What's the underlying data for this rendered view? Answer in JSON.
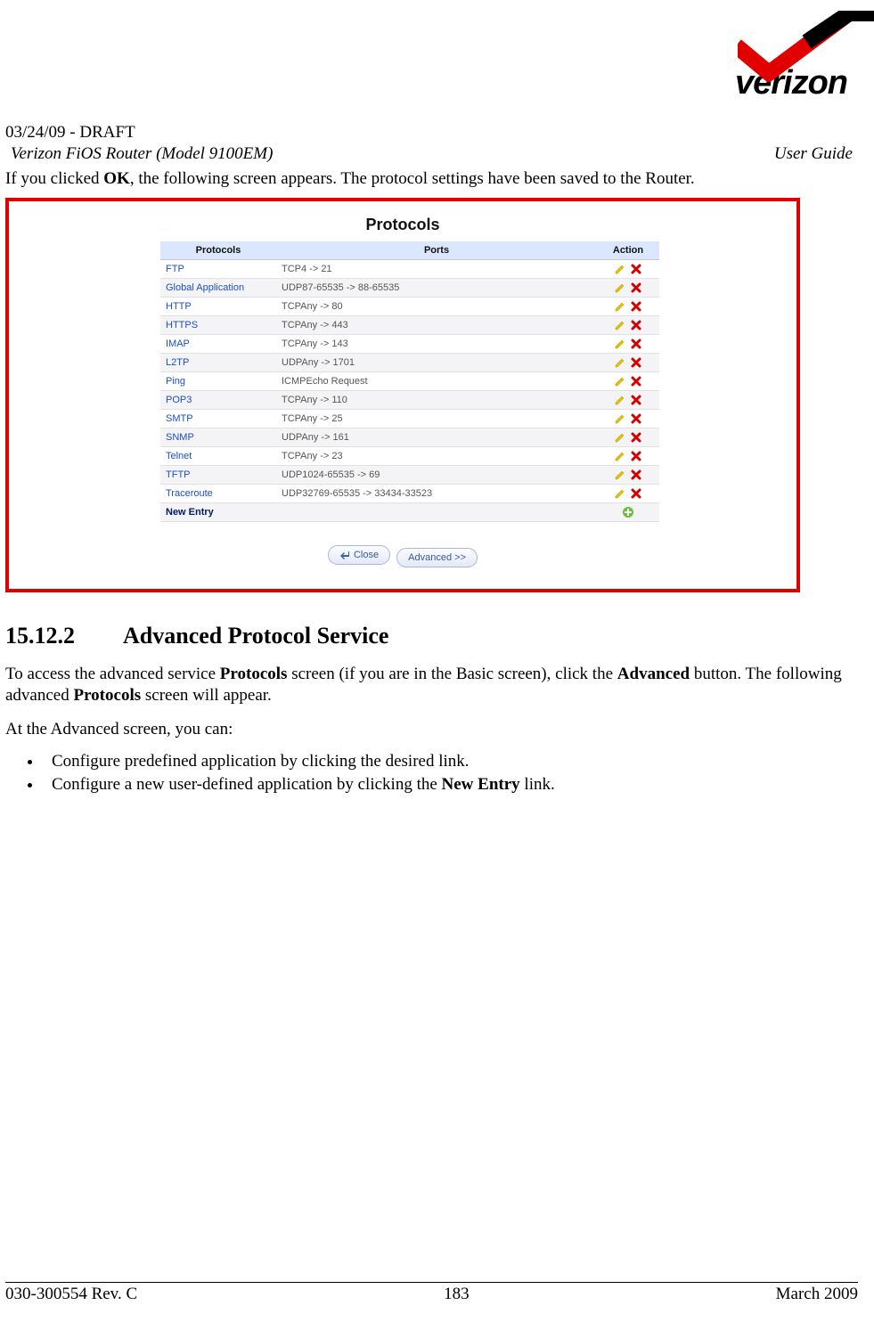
{
  "logo": {
    "brand": "verizon"
  },
  "header": {
    "draft": "03/24/09 - DRAFT",
    "left": "Verizon FiOS Router (Model 9100EM)",
    "right": "User Guide"
  },
  "intro": {
    "pre": "If you clicked ",
    "bold1": "OK",
    "post": ", the following screen appears. The protocol settings have been saved to the Router."
  },
  "panel": {
    "title": "Protocols",
    "columns": {
      "c1": "Protocols",
      "c2": "Ports",
      "c3": "Action"
    },
    "rows": [
      {
        "name": "FTP",
        "ports": "TCP4 -> 21"
      },
      {
        "name": "Global Application",
        "ports": "UDP87-65535 -> 88-65535"
      },
      {
        "name": "HTTP",
        "ports": "TCPAny -> 80"
      },
      {
        "name": "HTTPS",
        "ports": "TCPAny -> 443"
      },
      {
        "name": "IMAP",
        "ports": "TCPAny -> 143"
      },
      {
        "name": "L2TP",
        "ports": "UDPAny -> 1701"
      },
      {
        "name": "Ping",
        "ports": "ICMPEcho Request"
      },
      {
        "name": "POP3",
        "ports": "TCPAny -> 110"
      },
      {
        "name": "SMTP",
        "ports": "TCPAny -> 25"
      },
      {
        "name": "SNMP",
        "ports": "UDPAny -> 161"
      },
      {
        "name": "Telnet",
        "ports": "TCPAny -> 23"
      },
      {
        "name": "TFTP",
        "ports": "UDP1024-65535 -> 69"
      },
      {
        "name": "Traceroute",
        "ports": "UDP32769-65535 -> 33434-33523"
      }
    ],
    "new_entry": "New Entry",
    "buttons": {
      "close": "Close",
      "advanced": "Advanced >>"
    }
  },
  "section": {
    "num": "15.12.2",
    "title": "Advanced Protocol Service",
    "p1_a": "To access the advanced service ",
    "p1_b": "Protocols",
    "p1_c": " screen (if you are in the Basic screen), click the ",
    "p1_d": "Advanced",
    "p1_e": " button. The following advanced ",
    "p1_f": "Protocols",
    "p1_g": " screen will appear.",
    "p2": "At the Advanced screen, you can:",
    "bullets": [
      {
        "a": "Configure predefined application by clicking the desired link."
      },
      {
        "b_pre": "Configure a new user-defined application by clicking the ",
        "b_bold": "New Entry",
        "b_post": " link."
      }
    ]
  },
  "footer": {
    "left": "030-300554 Rev. C",
    "center": "183",
    "right": "March 2009"
  }
}
